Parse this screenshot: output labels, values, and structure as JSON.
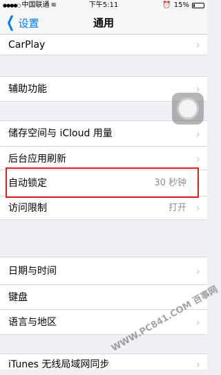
{
  "status_bar": {
    "carrier": "中国联通",
    "time": "下午5:11",
    "battery": "15%",
    "battery_level": 0.15
  },
  "nav": {
    "back_label": "设置",
    "title": "通用"
  },
  "rows": {
    "carplay": "CarPlay",
    "accessibility": "辅助功能",
    "storage": "储存空间与 iCloud 用量",
    "background_refresh": "后台应用刷新",
    "auto_lock": {
      "label": "自动锁定",
      "value": "30 秒钟"
    },
    "restrictions": {
      "label": "访问限制",
      "value": "打开"
    },
    "date_time": "日期与时间",
    "keyboard": "键盘",
    "language_region": "语言与地区",
    "itunes_sync": "iTunes 无线局域网同步"
  },
  "watermark": "WWW.PC841.COM 百事网",
  "colors": {
    "accent": "#007aff",
    "highlight": "#e02020",
    "background": "#efeff4"
  }
}
